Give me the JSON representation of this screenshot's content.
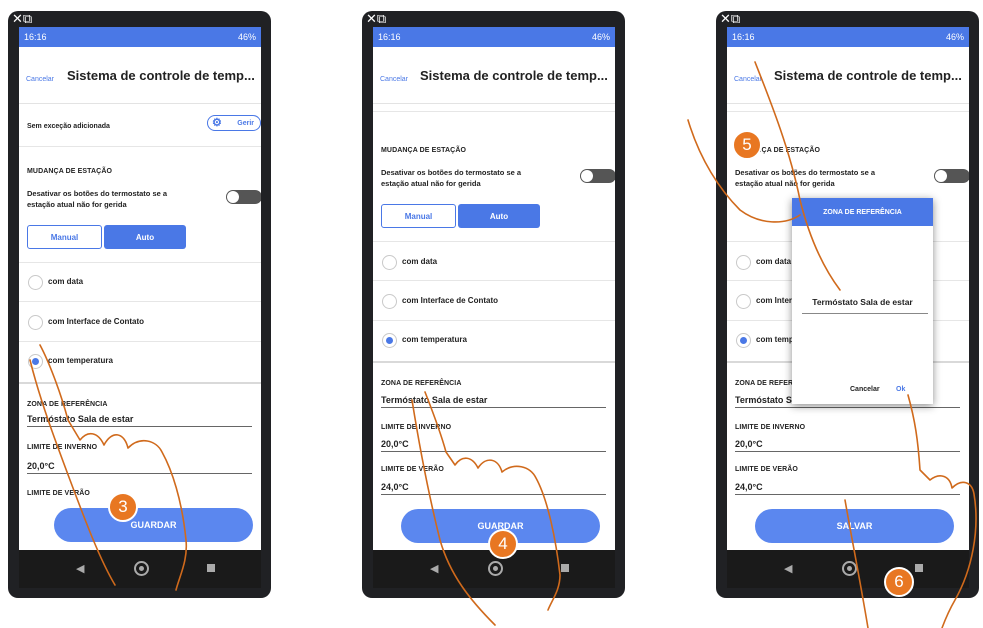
{
  "status": {
    "time": "16:16",
    "battery": "46%"
  },
  "screen1": {
    "cancel": "Cancelar",
    "title": "Sistema de controle de temp...",
    "no_exception": "Sem exceção adicionada",
    "manage": "Gerir",
    "season_section": "MUDANÇA DE ESTAÇÃO",
    "disable_text_1": "Desativar os botões do termostato se a",
    "disable_text_2": "estação atual não for gerida",
    "manual": "Manual",
    "auto": "Auto",
    "opt_date": "com data",
    "opt_contact": "com Interface de Contato",
    "opt_temp": "com temperatura",
    "zone_label": "ZONA DE REFERÊNCIA",
    "zone_value": "Termóstato Sala de estar",
    "winter_label": "LIMITE DE INVERNO",
    "winter_value": "20,0°C",
    "summer_label": "LIMITE DE VERÃO",
    "save": "GUARDAR",
    "step": "3"
  },
  "screen2": {
    "cancel": "Cancelar",
    "title": "Sistema de controle de temp...",
    "season_section": "MUDANÇA DE ESTAÇÃO",
    "disable_text_1": "Desativar os botões do termostato se a",
    "disable_text_2": "estação atual não for gerida",
    "manual": "Manual",
    "auto": "Auto",
    "opt_date": "com data",
    "opt_contact": "com Interface de Contato",
    "opt_temp": "com temperatura",
    "zone_label": "ZONA DE REFERÊNCIA",
    "zone_value": "Termóstato Sala de estar",
    "winter_label": "LIMITE DE INVERNO",
    "winter_value": "20,0°C",
    "summer_label": "LIMITE DE VERÃO",
    "summer_value": "24,0°C",
    "save": "GUARDAR",
    "step": "4"
  },
  "screen3": {
    "cancel": "Cancelar",
    "title": "Sistema de controle de temp...",
    "season_section": "MUDANÇA DE ESTAÇÃO",
    "disable_text_1": "Desativar os botões do termostato se a",
    "disable_text_2": "estação atual não for gerida",
    "opt_date": "com data",
    "opt_contact": "com Interface de Contato",
    "opt_temp": "com temperatura",
    "zone_label": "ZONA DE REFERÊNCIA",
    "zone_value": "Termóstato Sala de estar",
    "winter_label": "LIMITE DE INVERNO",
    "winter_value": "20,0°C",
    "summer_label": "LIMITE DE VERÃO",
    "summer_value": "24,0°C",
    "save": "SALVAR",
    "dialog_title": "ZONA DE REFERÊNCIA",
    "dialog_value": "Termóstato Sala de estar",
    "dialog_cancel": "Cancelar",
    "dialog_ok": "Ok",
    "step_a": "5",
    "step_b": "6"
  },
  "colors": {
    "accent": "#4a78e6",
    "step": "#e87722",
    "hand_stroke": "#d06a1c"
  }
}
